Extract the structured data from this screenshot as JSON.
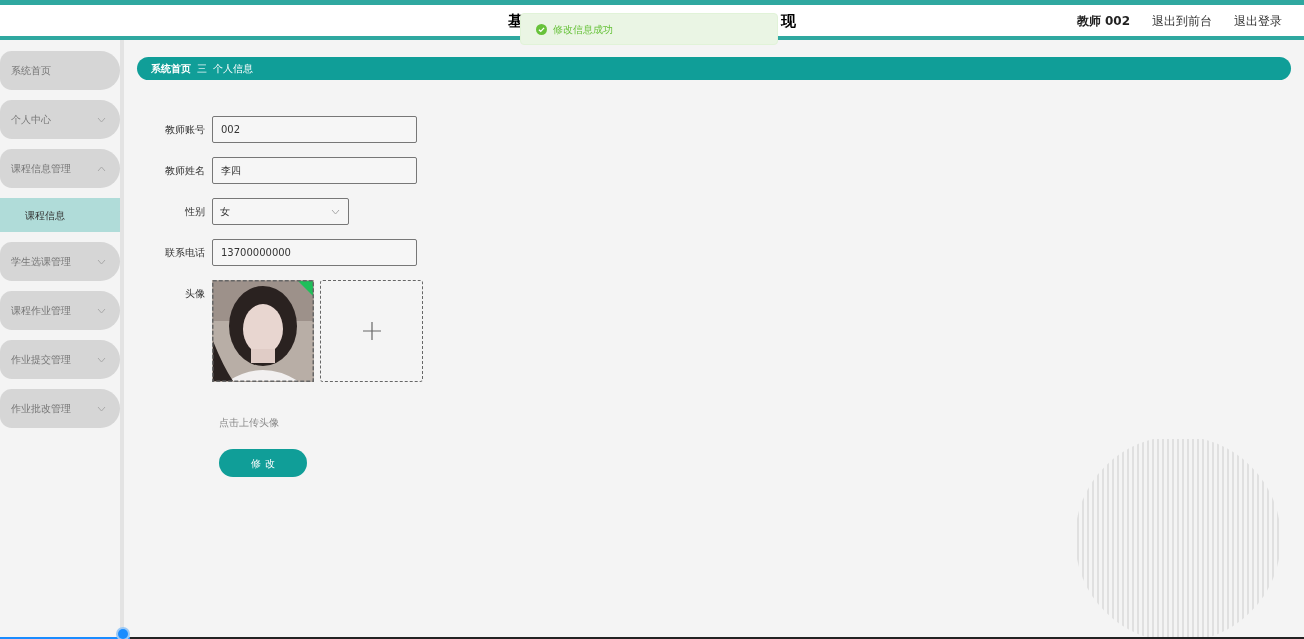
{
  "header": {
    "title_start": "基",
    "title_end": "现",
    "user": "教师 002",
    "links": [
      "退出到前台",
      "退出登录"
    ]
  },
  "toast": {
    "message": "修改信息成功",
    "kind": "success"
  },
  "sidebar": {
    "items": [
      {
        "label": "系统首页",
        "kind": "link"
      },
      {
        "label": "个人中心",
        "kind": "menu",
        "expanded": false
      },
      {
        "label": "课程信息管理",
        "kind": "menu",
        "expanded": true,
        "children": [
          {
            "label": "课程信息",
            "selected": true
          }
        ]
      },
      {
        "label": "学生选课管理",
        "kind": "menu",
        "expanded": false
      },
      {
        "label": "课程作业管理",
        "kind": "menu",
        "expanded": false
      },
      {
        "label": "作业提交管理",
        "kind": "menu",
        "expanded": false
      },
      {
        "label": "作业批改管理",
        "kind": "menu",
        "expanded": false
      }
    ]
  },
  "breadcrumb": {
    "items": [
      "系统首页",
      "个人信息"
    ],
    "separator": "三"
  },
  "form": {
    "fields": [
      {
        "label": "教师账号",
        "kind": "text",
        "value": "002"
      },
      {
        "label": "教师姓名",
        "kind": "text",
        "value": "李四"
      },
      {
        "label": "性别",
        "kind": "select",
        "value": "女"
      },
      {
        "label": "联系电话",
        "kind": "text",
        "value": "13700000000"
      },
      {
        "label": "头像"
      }
    ],
    "upload_hint": "点击上传头像",
    "submit": "修 改"
  },
  "playback": {
    "level": 0.1
  }
}
